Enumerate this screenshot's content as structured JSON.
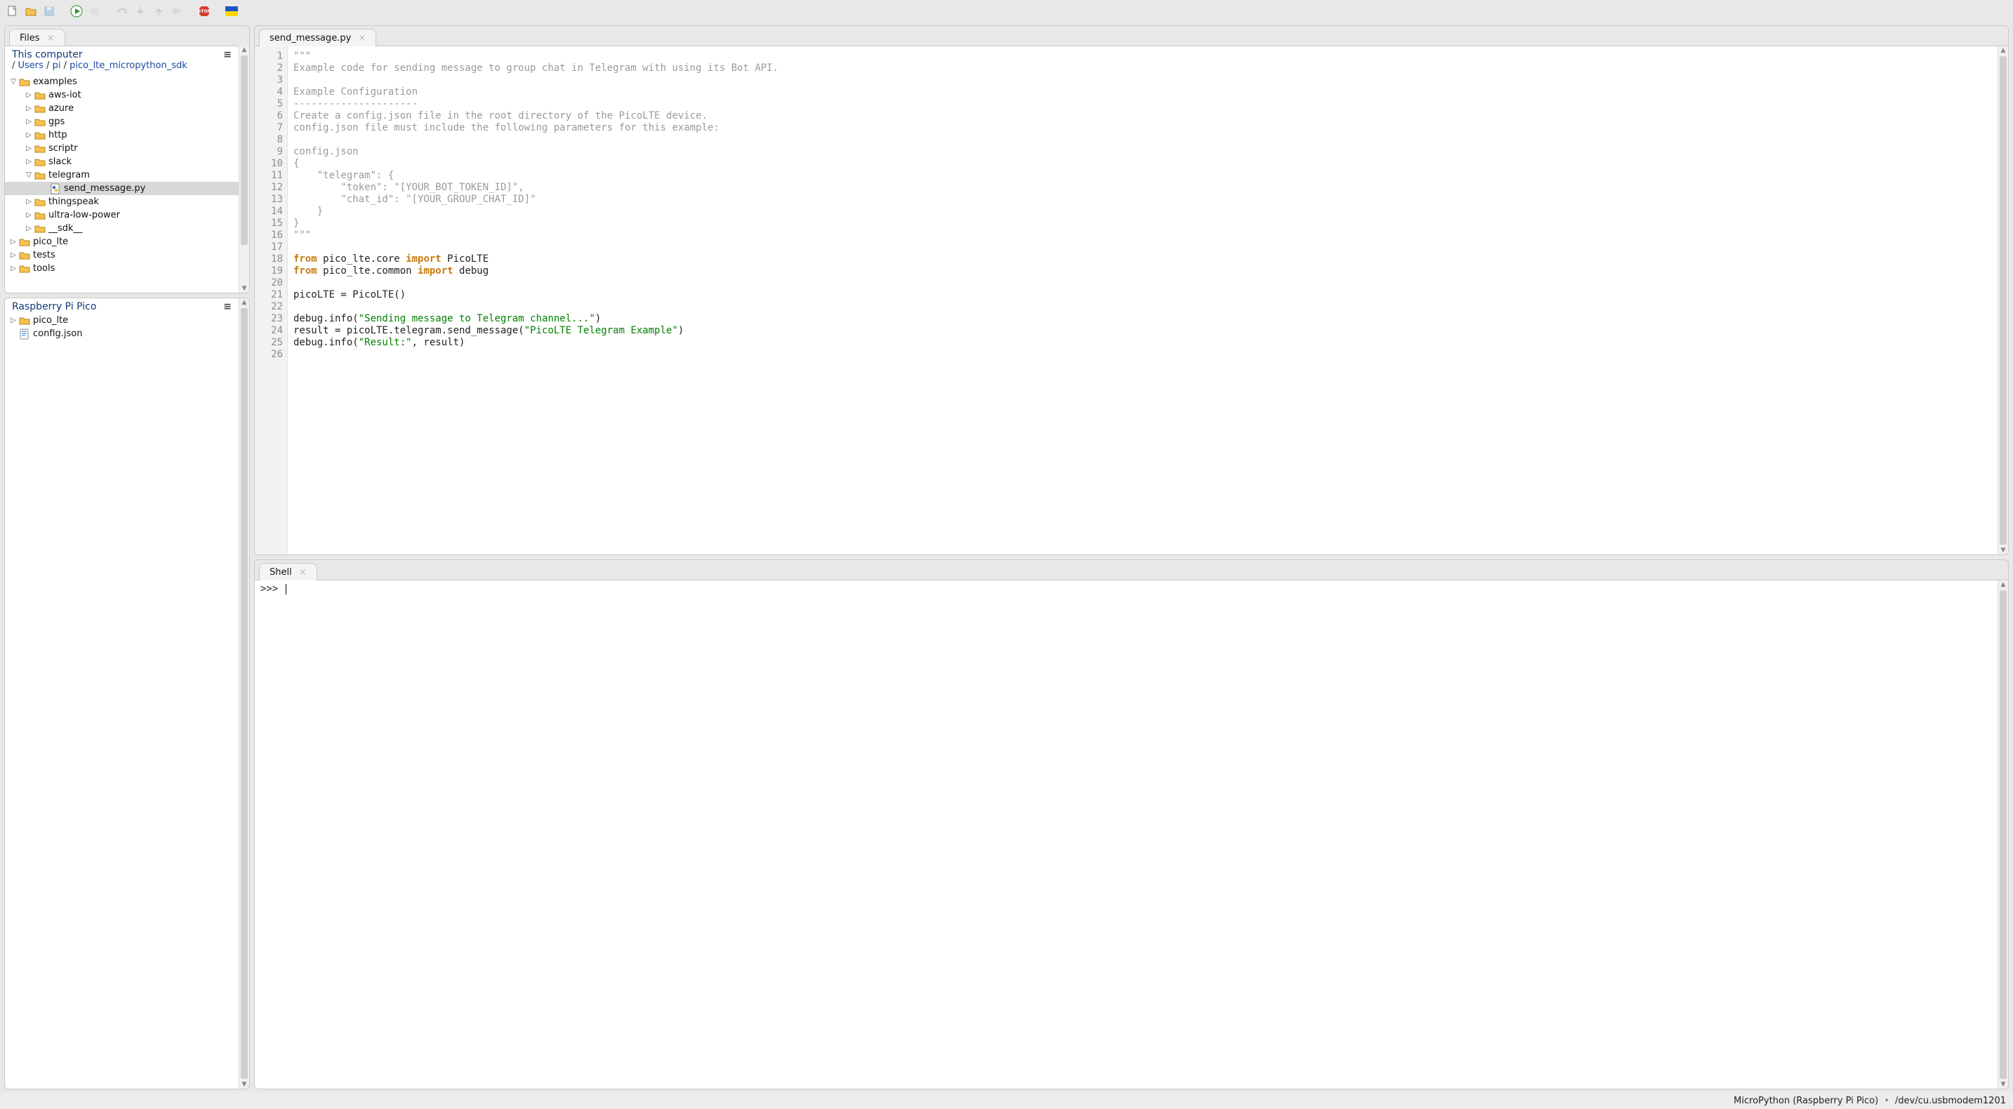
{
  "toolbar": {
    "icons": [
      "new-file",
      "open-file",
      "save-file",
      "run",
      "debug",
      "step-over",
      "step-into",
      "step-out",
      "resume",
      "stop",
      "toggle-languages"
    ]
  },
  "files_tab": {
    "label": "Files"
  },
  "this_computer": {
    "title": "This computer",
    "path": [
      "Users",
      "pi",
      "pico_lte_micropython_sdk"
    ],
    "tree": [
      {
        "indent": 0,
        "twisty": "open",
        "icon": "folder",
        "label": "examples"
      },
      {
        "indent": 1,
        "twisty": "closed",
        "icon": "folder",
        "label": "aws-iot"
      },
      {
        "indent": 1,
        "twisty": "closed",
        "icon": "folder",
        "label": "azure"
      },
      {
        "indent": 1,
        "twisty": "closed",
        "icon": "folder",
        "label": "gps"
      },
      {
        "indent": 1,
        "twisty": "closed",
        "icon": "folder",
        "label": "http"
      },
      {
        "indent": 1,
        "twisty": "closed",
        "icon": "folder",
        "label": "scriptr"
      },
      {
        "indent": 1,
        "twisty": "closed",
        "icon": "folder",
        "label": "slack"
      },
      {
        "indent": 1,
        "twisty": "open",
        "icon": "folder",
        "label": "telegram"
      },
      {
        "indent": 2,
        "twisty": "none",
        "icon": "python",
        "label": "send_message.py",
        "selected": true
      },
      {
        "indent": 1,
        "twisty": "closed",
        "icon": "folder",
        "label": "thingspeak"
      },
      {
        "indent": 1,
        "twisty": "closed",
        "icon": "folder",
        "label": "ultra-low-power"
      },
      {
        "indent": 1,
        "twisty": "closed",
        "icon": "folder",
        "label": "__sdk__"
      },
      {
        "indent": 0,
        "twisty": "closed",
        "icon": "folder",
        "label": "pico_lte"
      },
      {
        "indent": 0,
        "twisty": "closed",
        "icon": "folder",
        "label": "tests"
      },
      {
        "indent": 0,
        "twisty": "closed",
        "icon": "folder",
        "label": "tools"
      }
    ]
  },
  "pico_tree": {
    "title": "Raspberry Pi Pico",
    "tree": [
      {
        "indent": 0,
        "twisty": "closed",
        "icon": "folder",
        "label": "pico_lte"
      },
      {
        "indent": 0,
        "twisty": "none",
        "icon": "json",
        "label": "config.json"
      }
    ]
  },
  "editor": {
    "tab_label": "send_message.py",
    "lines": [
      {
        "t": "doc",
        "text": "\"\"\""
      },
      {
        "t": "doc",
        "text": "Example code for sending message to group chat in Telegram with using its Bot API."
      },
      {
        "t": "doc",
        "text": ""
      },
      {
        "t": "doc",
        "text": "Example Configuration"
      },
      {
        "t": "doc",
        "text": "---------------------"
      },
      {
        "t": "doc",
        "text": "Create a config.json file in the root directory of the PicoLTE device."
      },
      {
        "t": "doc",
        "text": "config.json file must include the following parameters for this example:"
      },
      {
        "t": "doc",
        "text": ""
      },
      {
        "t": "doc",
        "text": "config.json"
      },
      {
        "t": "doc",
        "text": "{"
      },
      {
        "t": "doc",
        "text": "    \"telegram\": {"
      },
      {
        "t": "doc",
        "text": "        \"token\": \"[YOUR_BOT_TOKEN_ID]\","
      },
      {
        "t": "doc",
        "text": "        \"chat_id\": \"[YOUR_GROUP_CHAT_ID]\""
      },
      {
        "t": "doc",
        "text": "    }"
      },
      {
        "t": "doc",
        "text": "}"
      },
      {
        "t": "doc",
        "text": "\"\"\""
      },
      {
        "t": "blank",
        "text": ""
      },
      {
        "t": "import",
        "kw1": "from",
        "between1": " pico_lte.core ",
        "kw2": "import",
        "rest": " PicoLTE"
      },
      {
        "t": "import",
        "kw1": "from",
        "between1": " pico_lte.common ",
        "kw2": "import",
        "rest": " debug"
      },
      {
        "t": "blank",
        "text": ""
      },
      {
        "t": "plain",
        "text": "picoLTE = PicoLTE()"
      },
      {
        "t": "blank",
        "text": ""
      },
      {
        "t": "call",
        "pre": "debug.info(",
        "str": "\"Sending message to Telegram channel...\"",
        "post": ")"
      },
      {
        "t": "call",
        "pre": "result = picoLTE.telegram.send_message(",
        "str": "\"PicoLTE Telegram Example\"",
        "post": ")"
      },
      {
        "t": "call",
        "pre": "debug.info(",
        "str": "\"Result:\"",
        "post": ", result)"
      },
      {
        "t": "blank",
        "text": ""
      }
    ]
  },
  "shell": {
    "tab_label": "Shell",
    "prompt": ">>> "
  },
  "statusbar": {
    "interpreter": "MicroPython (Raspberry Pi Pico)",
    "port": "/dev/cu.usbmodem1201"
  }
}
